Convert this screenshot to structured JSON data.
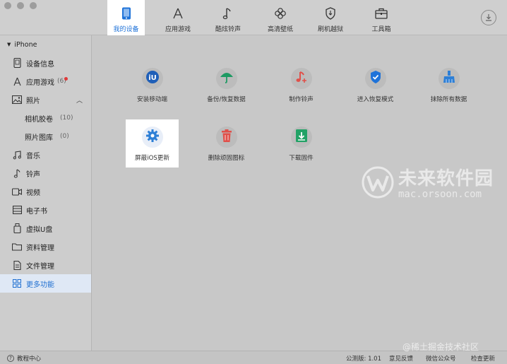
{
  "toolbar": {
    "tabs": [
      {
        "label": "我的设备",
        "icon": "phone-icon"
      },
      {
        "label": "应用游戏",
        "icon": "app-store-icon"
      },
      {
        "label": "酷炫铃声",
        "icon": "music-note-icon"
      },
      {
        "label": "高清壁纸",
        "icon": "flower-icon"
      },
      {
        "label": "刷机越狱",
        "icon": "shield-icon"
      },
      {
        "label": "工具箱",
        "icon": "toolbox-icon"
      }
    ],
    "active_tab": "我的设备",
    "download_icon": "download-icon",
    "accent_color": "#1f73d9"
  },
  "sidebar": {
    "device_name": "iPhone",
    "items": [
      {
        "label": "设备信息",
        "icon": "device-info-icon"
      },
      {
        "label": "应用游戏",
        "icon": "app-store-icon",
        "count": "(6)",
        "badge": "red-dot"
      },
      {
        "label": "照片",
        "icon": "photo-icon"
      },
      {
        "label": "相机胶卷",
        "count": "(10)"
      },
      {
        "label": "照片图库",
        "count": "(0)"
      },
      {
        "label": "音乐",
        "icon": "music-icon"
      },
      {
        "label": "铃声",
        "icon": "ringtone-icon"
      },
      {
        "label": "视频",
        "icon": "video-icon"
      },
      {
        "label": "电子书",
        "icon": "ebook-icon"
      },
      {
        "label": "虚拟U盘",
        "icon": "usb-drive-icon"
      },
      {
        "label": "资料管理",
        "icon": "folder-icon"
      },
      {
        "label": "文件管理",
        "icon": "file-icon"
      },
      {
        "label": "更多功能",
        "icon": "grid-icon"
      }
    ],
    "active_item": "更多功能"
  },
  "main": {
    "tools": [
      {
        "label": "安装移动端",
        "icon": "install-mobile-icon",
        "color": "#1f5fb8"
      },
      {
        "label": "备份/恢复数据",
        "icon": "umbrella-icon",
        "color": "#1e9a63"
      },
      {
        "label": "制作铃声",
        "icon": "make-ringtone-icon",
        "color": "#e0504a"
      },
      {
        "label": "进入恢复模式",
        "icon": "recovery-shield-icon",
        "color": "#1f73d9"
      },
      {
        "label": "抹除所有数据",
        "icon": "erase-brush-icon",
        "color": "#2d7fd6"
      },
      {
        "label": "屏蔽iOS更新",
        "icon": "gear-icon",
        "color": "#2d7fd6"
      },
      {
        "label": "删除顽固图标",
        "icon": "trash-icon",
        "color": "#e0504a"
      },
      {
        "label": "下载固件",
        "icon": "download-firmware-icon",
        "color": "#22a266"
      }
    ],
    "highlighted_tool": "屏蔽iOS更新"
  },
  "statusbar": {
    "help_label": "教程中心",
    "version": "公测版: 1.01",
    "feedback": "意见反馈",
    "wechat": "微信公众号",
    "update": "检查更新"
  },
  "watermark": {
    "title": "未来软件园",
    "url": "mac.orsoon.com",
    "site": "@稀土掘金技术社区"
  }
}
